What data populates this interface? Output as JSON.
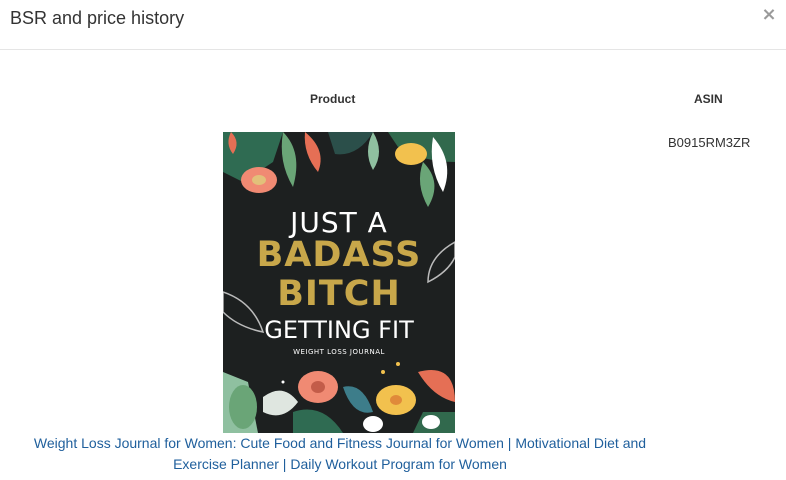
{
  "modal": {
    "title": "BSR and price history",
    "close_label": "×"
  },
  "table": {
    "headers": {
      "product": "Product",
      "asin": "ASIN"
    },
    "rows": [
      {
        "asin": "B0915RM3ZR",
        "product_title": "Weight Loss Journal for Women: Cute Food and Fitness Journal for Women | Motivational Diet and Exercise Planner | Daily Workout Program for Women",
        "cover": {
          "line1": "JUST A",
          "line2": "BADASS",
          "line3": "BITCH",
          "line4": "GETTING FIT",
          "line5": "WEIGHT LOSS JOURNAL"
        }
      }
    ]
  },
  "colors": {
    "link": "#1f5f9c",
    "cover_background": "#1d2020",
    "cover_gold": "#c8a74a"
  }
}
